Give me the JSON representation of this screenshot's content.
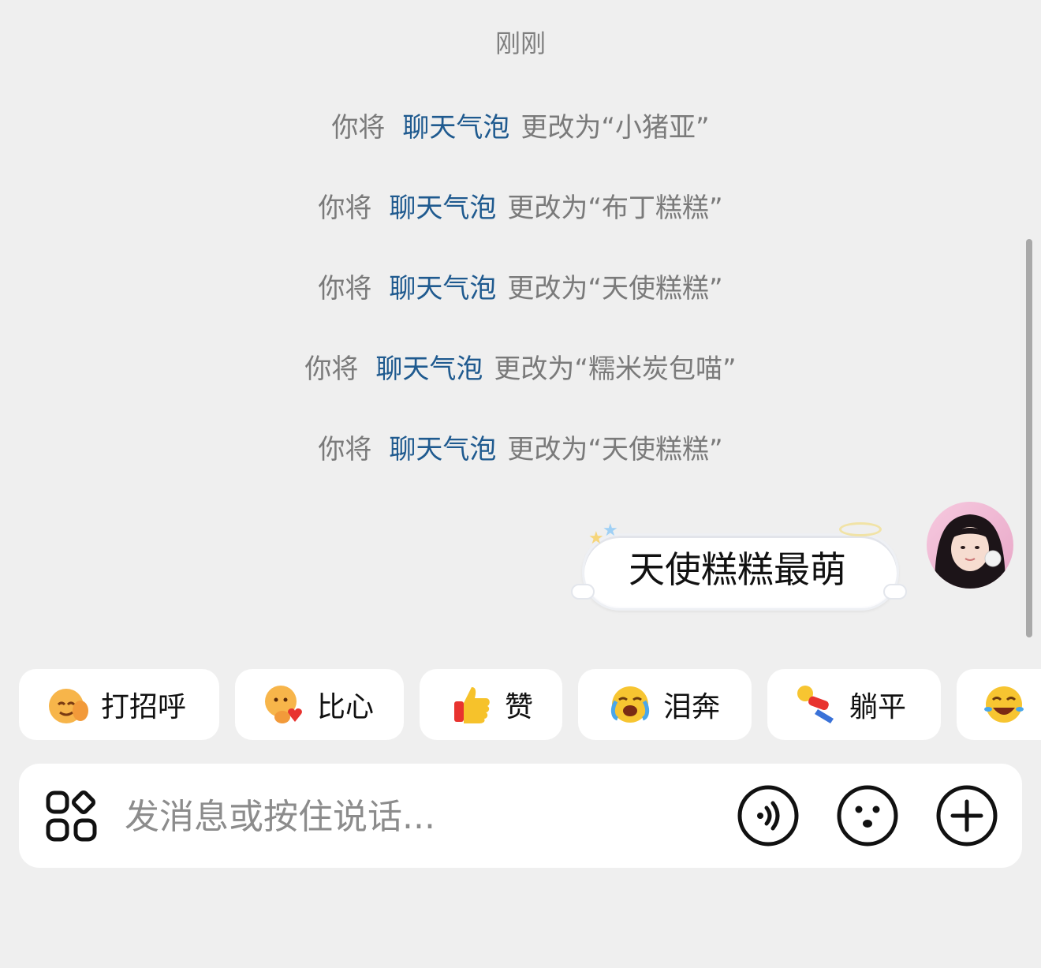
{
  "chat": {
    "timestamp": "刚刚",
    "notices": [
      {
        "prefix": "你将",
        "link": "聊天气泡",
        "suffix": "更改为“小猪亚”"
      },
      {
        "prefix": "你将",
        "link": "聊天气泡",
        "suffix": "更改为“布丁糕糕”"
      },
      {
        "prefix": "你将",
        "link": "聊天气泡",
        "suffix": "更改为“天使糕糕”"
      },
      {
        "prefix": "你将",
        "link": "聊天气泡",
        "suffix": "更改为“糯米炭包喵”"
      },
      {
        "prefix": "你将",
        "link": "聊天气泡",
        "suffix": "更改为“天使糕糕”"
      }
    ],
    "message": {
      "text": "天使糕糕最萌"
    }
  },
  "quick_replies": [
    {
      "label": "打招呼",
      "icon": "wave-emoji-icon"
    },
    {
      "label": "比心",
      "icon": "finger-heart-emoji-icon"
    },
    {
      "label": "赞",
      "icon": "thumbs-up-emoji-icon"
    },
    {
      "label": "泪奔",
      "icon": "crying-emoji-icon"
    },
    {
      "label": "躺平",
      "icon": "lying-flat-emoji-icon"
    },
    {
      "label": "",
      "icon": "laughing-tears-emoji-icon"
    }
  ],
  "input_bar": {
    "placeholder": "发消息或按住说话...",
    "icons": [
      "apps-icon",
      "voice-icon",
      "emoji-icon",
      "plus-icon"
    ]
  },
  "colors": {
    "background": "#efefef",
    "link": "#1f5a8f",
    "notice_text": "#7a7a7a"
  }
}
